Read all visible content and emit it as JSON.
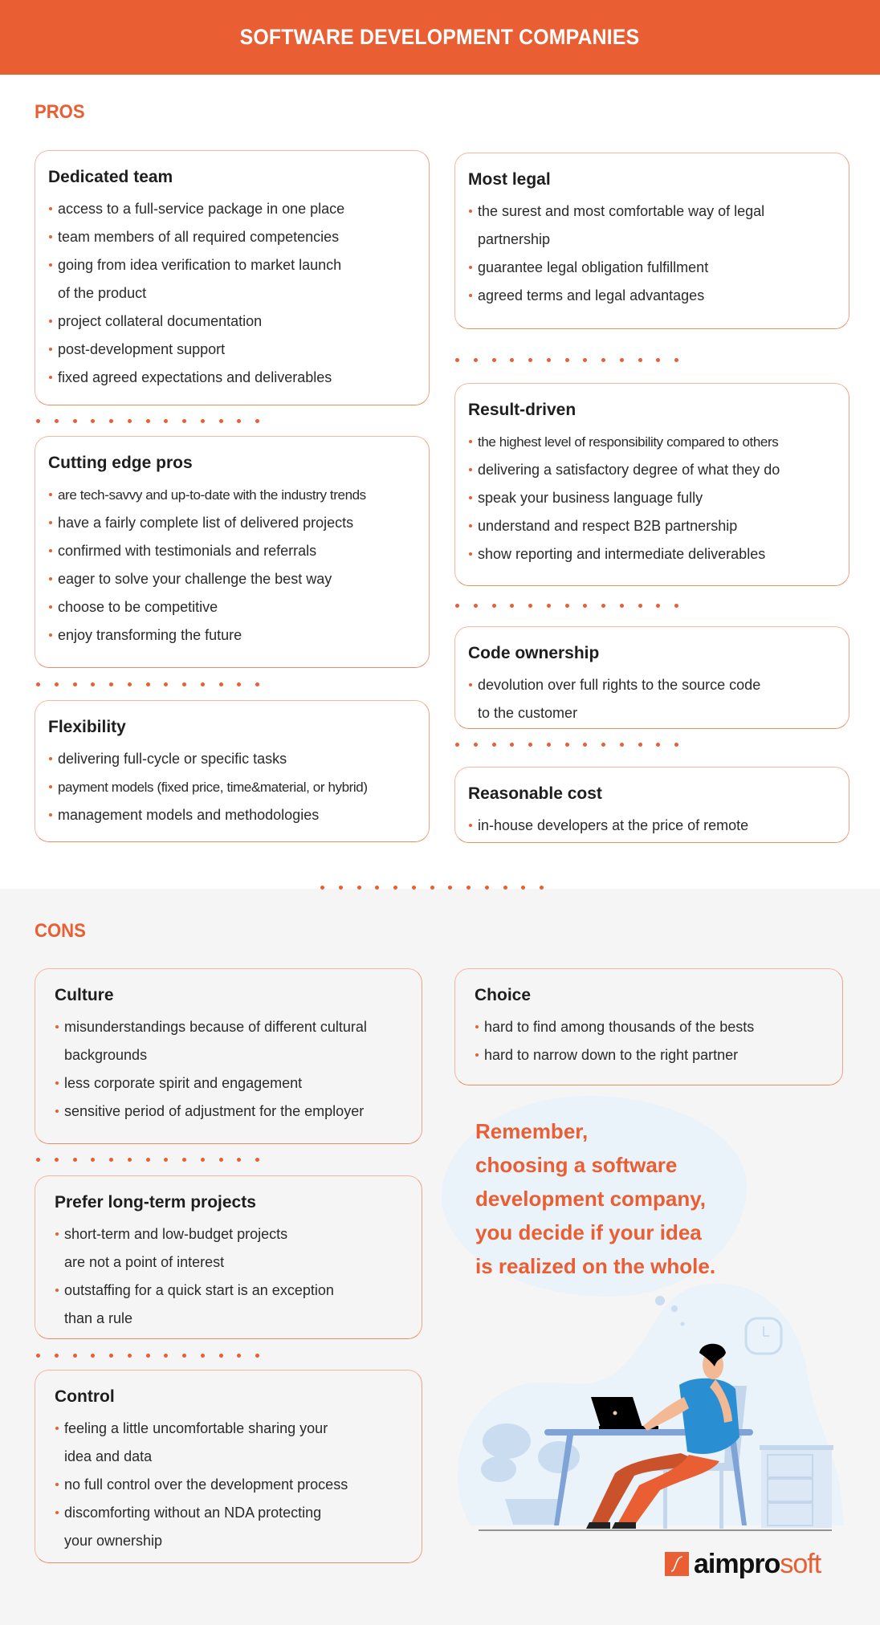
{
  "header": {
    "title": "SOFTWARE DEVELOPMENT COMPANIES"
  },
  "colors": {
    "accent": "#E95E33",
    "card_border": "#F6B79E",
    "cons_background": "#F5F5F5",
    "blob": "#EAF2FA"
  },
  "pros": {
    "heading": "PROS",
    "left": [
      {
        "title": "Dedicated team",
        "items": [
          "access to a full-service package in one place",
          "team members of all required competencies",
          "going from idea verification to market launch",
          "of the product",
          "project collateral documentation",
          "post-development support",
          "fixed agreed expectations and deliverables"
        ]
      },
      {
        "title": "Cutting edge pros",
        "items": [
          "are tech-savvy and up-to-date with the industry trends",
          "have a fairly complete list of delivered projects",
          "confirmed with testimonials and referrals",
          "eager to solve your challenge the best way",
          "choose to be competitive",
          "enjoy transforming the future"
        ]
      },
      {
        "title": "Flexibility",
        "items": [
          "delivering full-cycle or specific tasks",
          "payment models (fixed price, time&material, or hybrid)",
          "management models and methodologies"
        ]
      }
    ],
    "right": [
      {
        "title": "Most legal",
        "items": [
          "the surest and most comfortable way of legal",
          "partnership",
          "guarantee legal obligation fulfillment",
          "agreed terms and legal advantages"
        ]
      },
      {
        "title": "Result-driven",
        "items": [
          "the highest level of responsibility compared to others",
          "delivering a satisfactory degree of what they do",
          "speak your business language fully",
          "understand and respect B2B partnership",
          "show reporting and intermediate deliverables"
        ]
      },
      {
        "title": "Code ownership",
        "items": [
          "devolution over full rights to the source code",
          "to the customer"
        ]
      },
      {
        "title": "Reasonable cost",
        "items": [
          "in-house developers at the price of remote"
        ]
      }
    ]
  },
  "cons": {
    "heading": "CONS",
    "left": [
      {
        "title": "Culture",
        "items": [
          "misunderstandings because of different cultural",
          "backgrounds",
          "less corporate spirit and engagement",
          "sensitive period of adjustment for the employer"
        ]
      },
      {
        "title": "Prefer long-term projects",
        "items": [
          "short-term and low-budget projects",
          "are not a point of interest",
          "outstaffing for a quick start is an exception",
          "than a rule"
        ]
      },
      {
        "title": "Control",
        "items": [
          "feeling a little uncomfortable sharing your",
          "idea and data",
          "no full control over the development process",
          "discomforting without an NDA protecting",
          "your ownership"
        ]
      }
    ],
    "right": [
      {
        "title": "Choice",
        "items": [
          "hard to find among thousands of the bests",
          "hard to narrow down to the right partner"
        ]
      }
    ]
  },
  "quote": {
    "lines": [
      "Remember,",
      "choosing a software",
      "development company,",
      "you decide if your idea",
      "is realized on the whole."
    ]
  },
  "illustration": {
    "icon": "person-at-laptop-illustration"
  },
  "logo": {
    "part1": "aimpro",
    "part2": "soft",
    "icon": "aimprosoft-logo-mark"
  }
}
